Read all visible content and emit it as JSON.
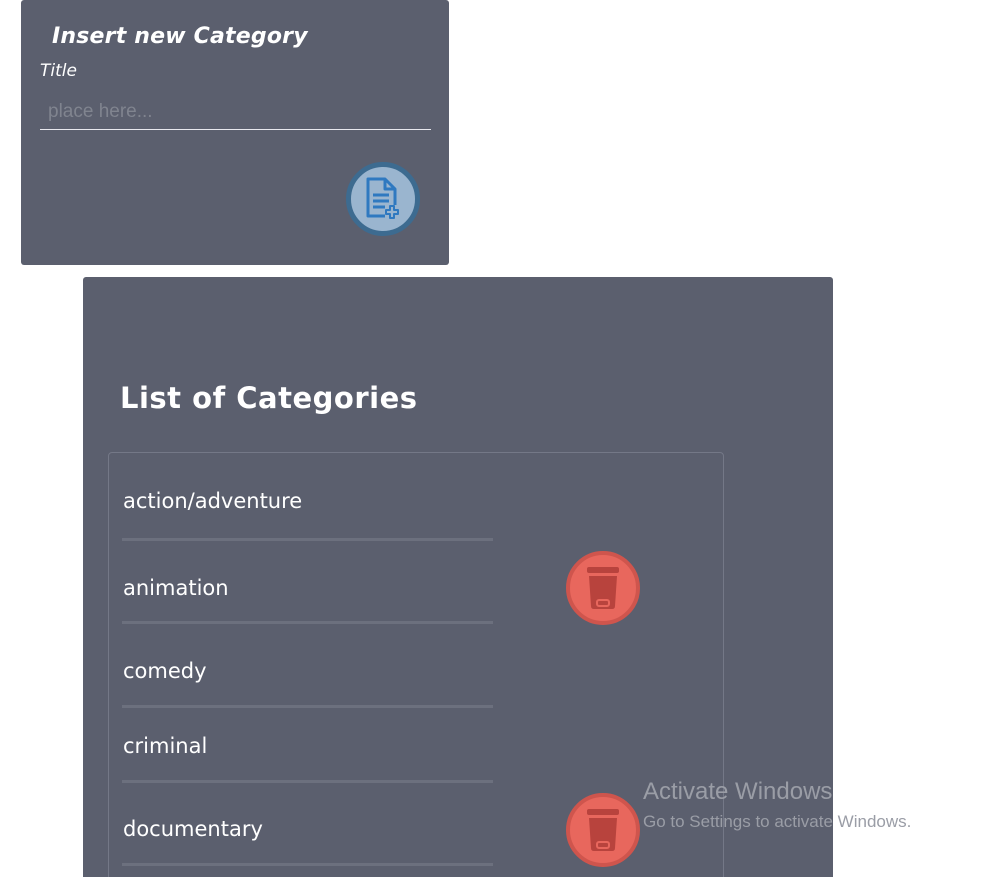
{
  "insert_panel": {
    "heading": "Insert new Category",
    "title_label": "Title",
    "title_input": {
      "value": "",
      "placeholder": "place here..."
    },
    "add_button_icon": "add-document-icon"
  },
  "list_panel": {
    "heading": "List of Categories",
    "items": [
      {
        "label": "action/adventure",
        "has_delete": false
      },
      {
        "label": "animation",
        "has_delete": true
      },
      {
        "label": "comedy",
        "has_delete": false
      },
      {
        "label": "criminal",
        "has_delete": false
      },
      {
        "label": "documentary",
        "has_delete": true
      }
    ],
    "delete_icon": "trash-icon"
  },
  "watermark": {
    "title": "Activate Windows",
    "subtitle": "Go to Settings to activate Windows."
  },
  "colors": {
    "panel_bg": "#5b5f6e",
    "add_button_fill": "#9ab5cf",
    "add_button_border": "#3d6b90",
    "add_icon": "#2f79c0",
    "delete_fill": "#e8675d",
    "delete_border": "#cf554d",
    "delete_icon": "#b8433d"
  }
}
